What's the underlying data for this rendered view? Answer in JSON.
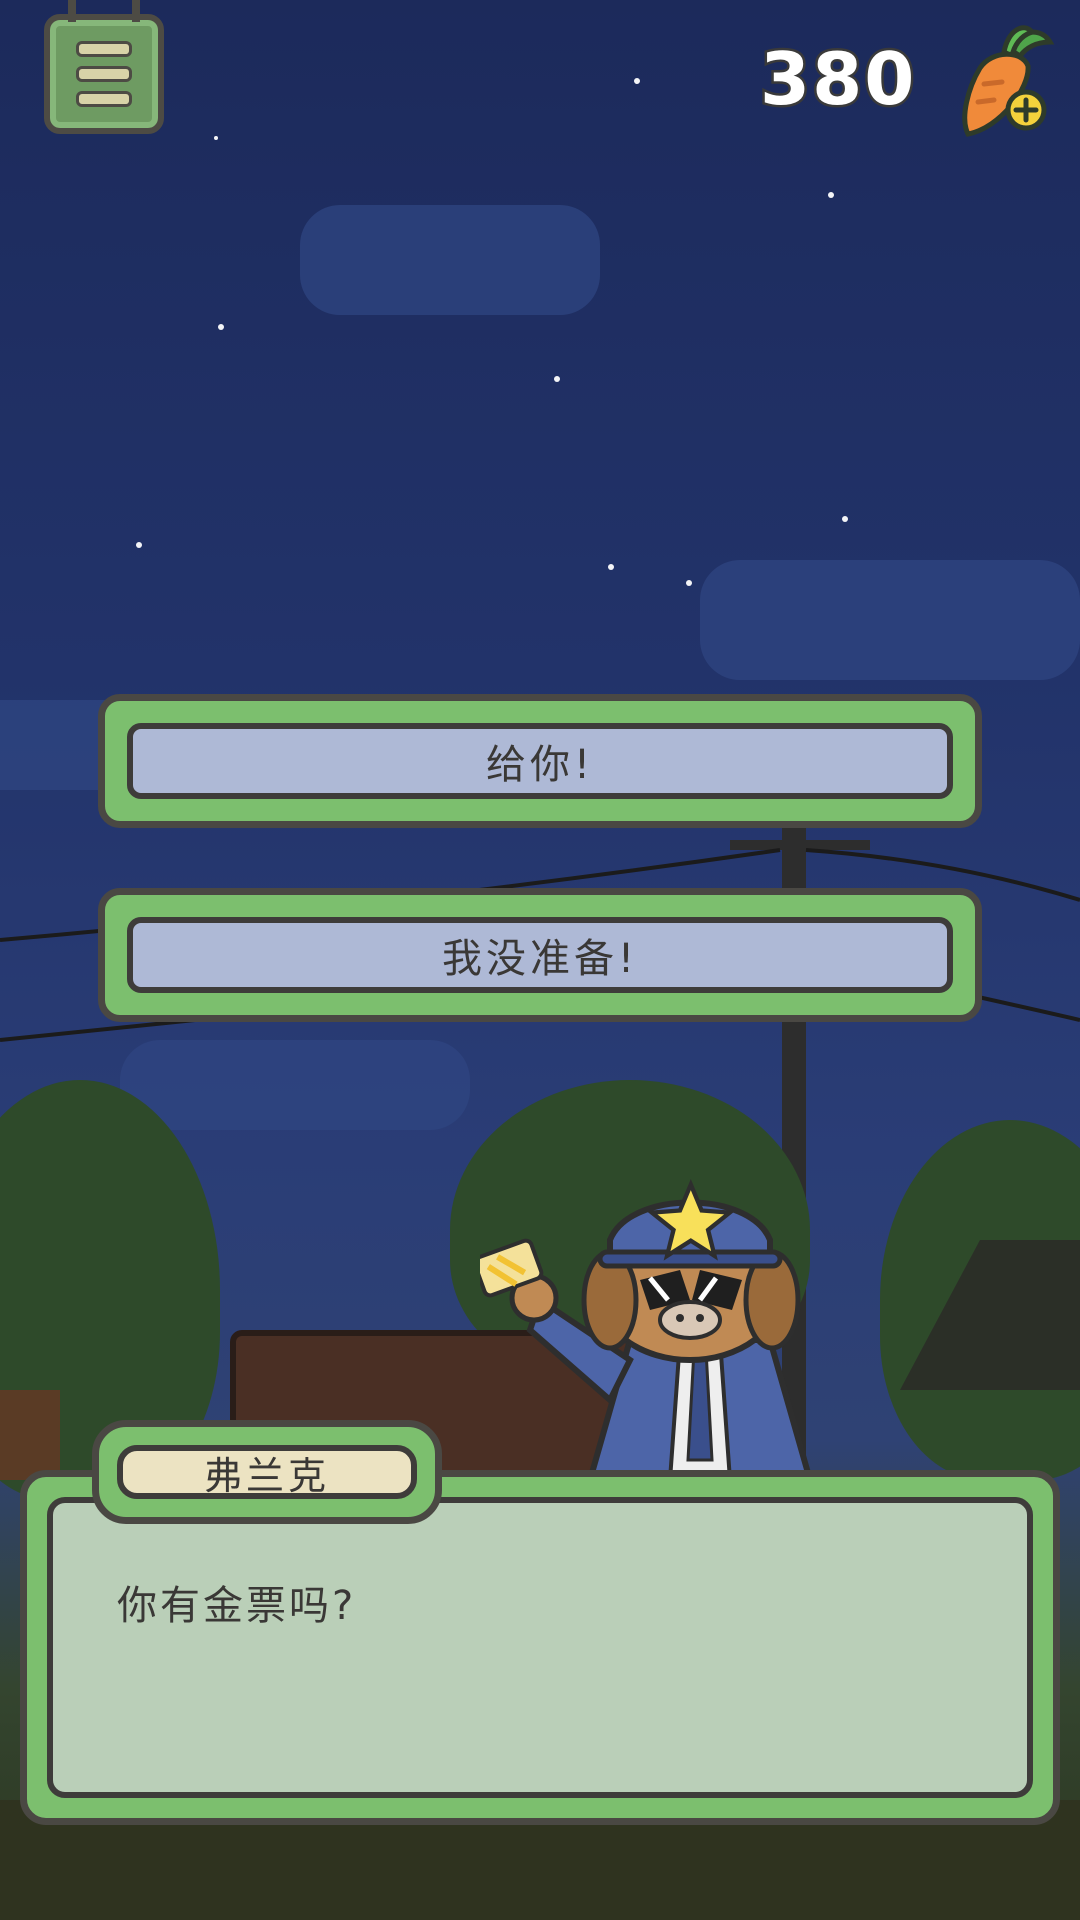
{
  "hud": {
    "carrot_count": "380",
    "menu_icon": "menu-icon",
    "currency_icon": "carrot-add-icon"
  },
  "choices": [
    {
      "label": "给你!"
    },
    {
      "label": "我没准备!"
    }
  ],
  "dialog": {
    "speaker": "弗兰克",
    "text": "你有金票吗?"
  },
  "colors": {
    "frame_green": "#7cbf6e",
    "frame_outline": "#4a4843",
    "button_fill": "#aeb9d6",
    "sky": "#22336a"
  }
}
